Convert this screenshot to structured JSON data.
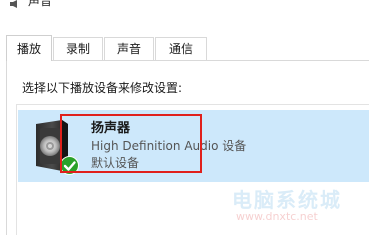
{
  "window": {
    "title": "声音",
    "icon": "speaker-small-icon"
  },
  "tabs": [
    {
      "label": "播放",
      "active": true
    },
    {
      "label": "录制",
      "active": false
    },
    {
      "label": "声音",
      "active": false
    },
    {
      "label": "通信",
      "active": false
    }
  ],
  "panel": {
    "instruction": "选择以下播放设备来修改设置:"
  },
  "device": {
    "name": "扬声器",
    "description": "High Definition Audio 设备",
    "status": "默认设备",
    "icon": "speaker-device-icon",
    "badge_icon": "green-check-icon",
    "selected": true
  },
  "colors": {
    "selection": "#cde8fb",
    "highlight": "#e0201b",
    "check": "#2aa12a"
  },
  "watermark": {
    "text": "电脑系统城",
    "url": "www.dnxtc.net"
  }
}
